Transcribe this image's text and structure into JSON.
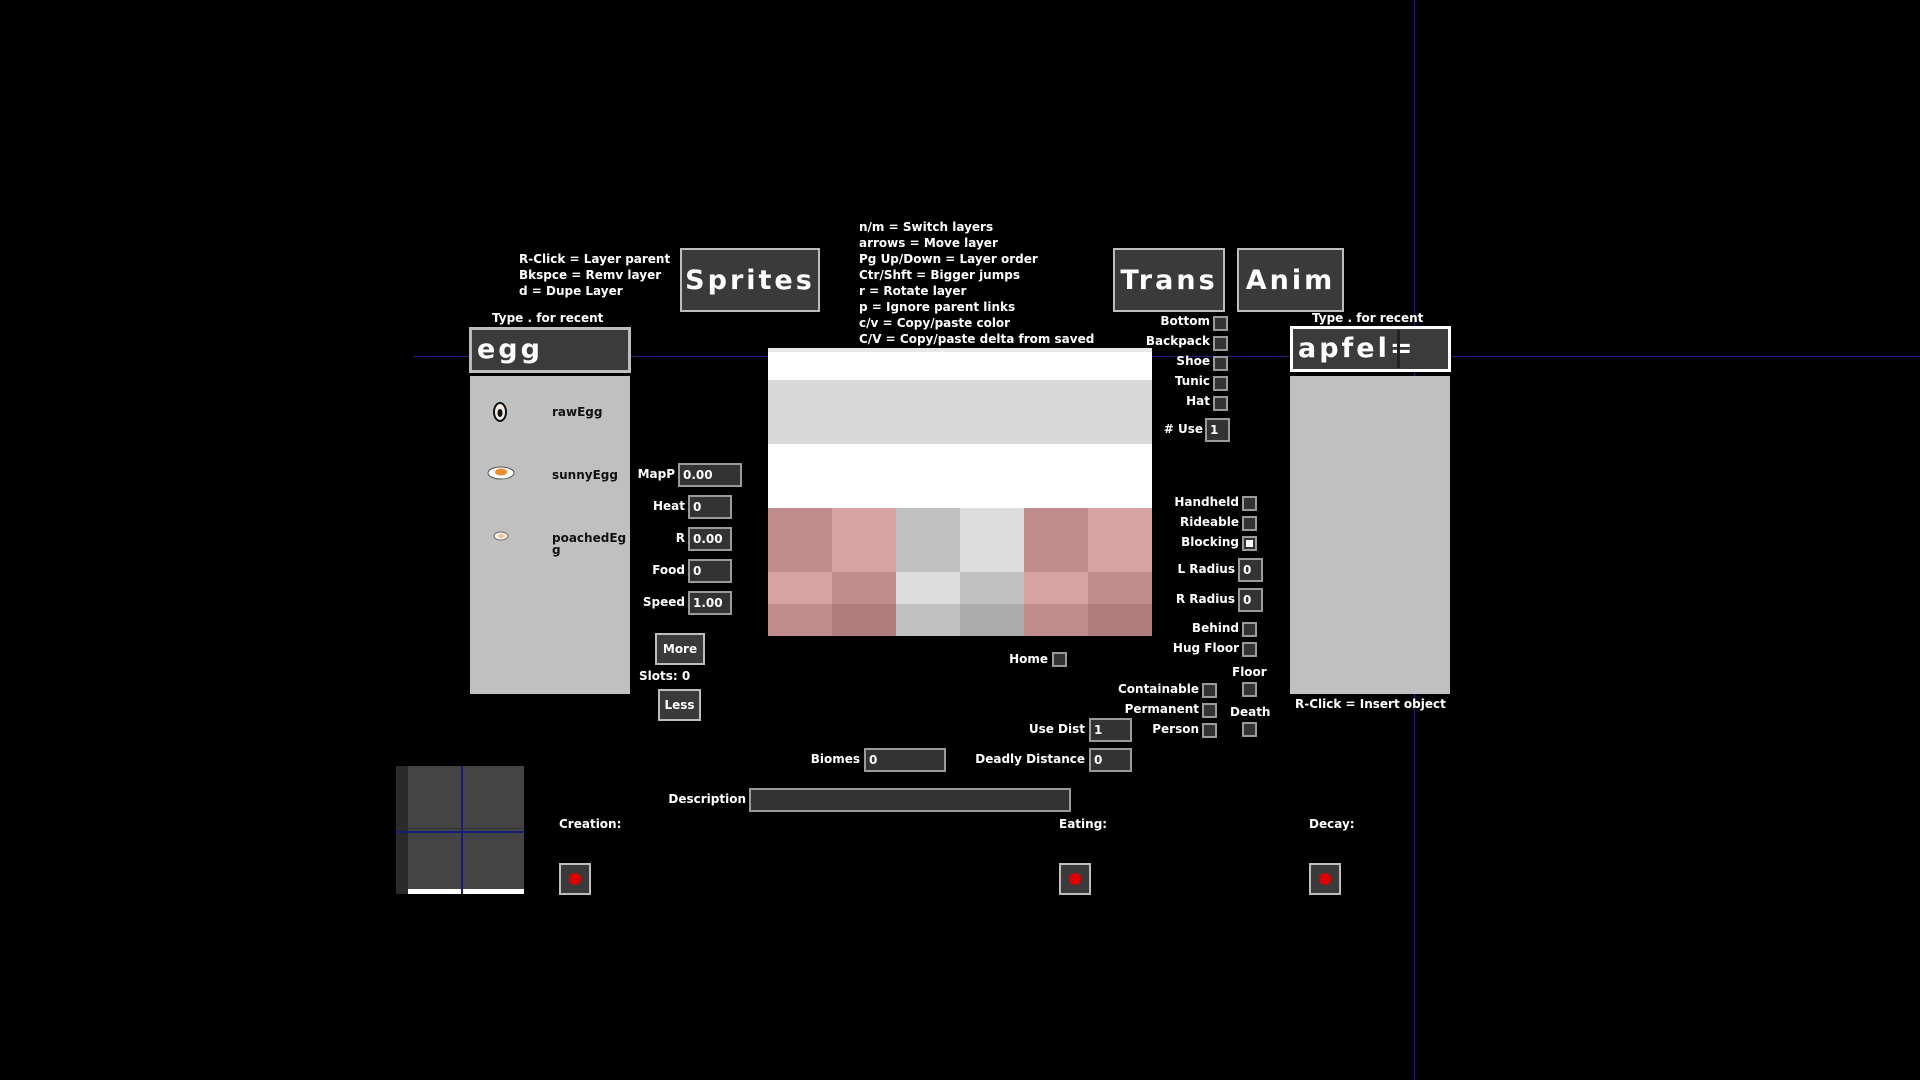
{
  "left_help": [
    "R-Click = Layer parent",
    "Bkspce = Remv layer",
    "d = Dupe Layer"
  ],
  "center_help": [
    "n/m = Switch layers",
    "arrows = Move layer",
    "Pg Up/Down = Layer order",
    "Ctr/Shft = Bigger jumps",
    "r = Rotate layer",
    "p = Ignore parent links",
    "c/v = Copy/paste color",
    "C/V = Copy/paste delta from saved"
  ],
  "buttons": {
    "sprites": "Sprites",
    "trans": "Trans",
    "anim": "Anim",
    "more": "More",
    "less": "Less"
  },
  "sprite_search": {
    "hint": "Type . for recent",
    "value": "egg"
  },
  "sprite_list": [
    {
      "name": "rawEgg",
      "icon": "raw-egg-icon"
    },
    {
      "name": "sunnyEgg",
      "icon": "sunny-egg-icon"
    },
    {
      "name": "poachedEgg",
      "icon": "poached-egg-icon"
    }
  ],
  "object_search": {
    "hint": "Type . for recent",
    "value": "apfel="
  },
  "object_hint": "R-Click = Insert object",
  "params": {
    "mapp": {
      "label": "MapP",
      "value": "0.00"
    },
    "heat": {
      "label": "Heat",
      "value": "0"
    },
    "r": {
      "label": "R",
      "value": "0.00"
    },
    "food": {
      "label": "Food",
      "value": "0"
    },
    "speed": {
      "label": "Speed",
      "value": "1.00"
    }
  },
  "slots": "Slots: 0",
  "clothing": {
    "bottom": "Bottom",
    "backpack": "Backpack",
    "shoe": "Shoe",
    "tunic": "Tunic",
    "hat": "Hat",
    "num_use_label": "# Use",
    "num_use_value": "1"
  },
  "props": {
    "handheld": "Handheld",
    "rideable": "Rideable",
    "blocking": "Blocking",
    "l_radius_label": "L Radius",
    "l_radius_value": "0",
    "r_radius_label": "R Radius",
    "r_radius_value": "0",
    "behind": "Behind",
    "hug_floor": "Hug Floor",
    "floor": "Floor",
    "death": "Death",
    "containable": "Containable",
    "permanent": "Permanent",
    "person": "Person",
    "use_dist_label": "Use Dist",
    "use_dist_value": "1",
    "home": "Home"
  },
  "biomes": {
    "label": "Biomes",
    "value": "0"
  },
  "deadly_distance": {
    "label": "Deadly Distance",
    "value": "0"
  },
  "description": {
    "label": "Description",
    "value": ""
  },
  "sounds": {
    "creation": "Creation:",
    "eating": "Eating:",
    "decay": "Decay:"
  },
  "colors": {
    "background": "#000000",
    "panel": "#c0c0c0",
    "button": "#3a3a3a",
    "record": "#e00000",
    "guide_line": "#1e1e78"
  }
}
